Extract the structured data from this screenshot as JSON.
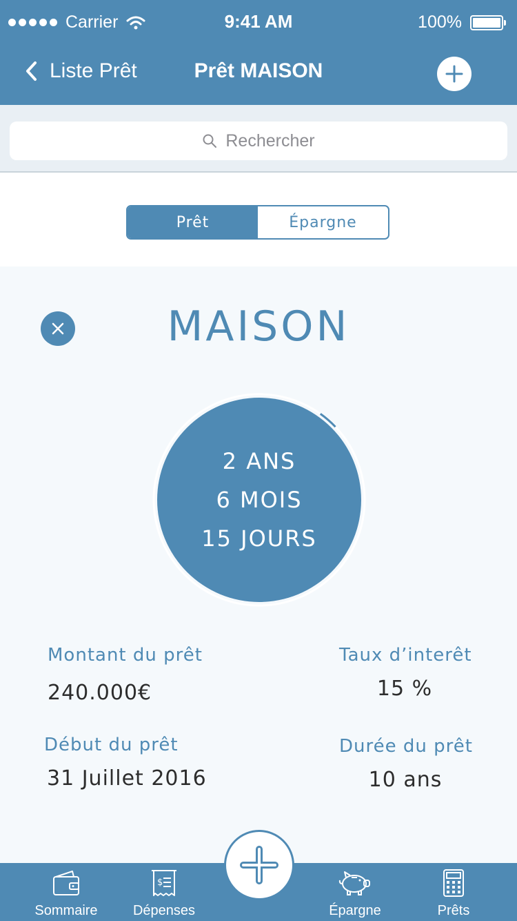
{
  "status_bar": {
    "carrier": "Carrier",
    "time": "9:41 AM",
    "battery": "100%"
  },
  "nav": {
    "back_label": "Liste Prêt",
    "title": "Prêt MAISON"
  },
  "search": {
    "placeholder": "Rechercher"
  },
  "segmented": {
    "options": [
      "Prêt",
      "Épargne"
    ],
    "selected": "Prêt"
  },
  "loan": {
    "name": "MAISON",
    "remaining": [
      "2 ANS",
      "6 MOIS",
      "15 JOURS"
    ],
    "progress_fraction": 0.97,
    "fields": {
      "amount_label": "Montant du prêt",
      "amount_value": "240.000€",
      "rate_label": "Taux d’interêt",
      "rate_value": "15 %",
      "start_label": "Début du prêt",
      "start_value": "31 Juillet 2016",
      "duration_label": "Durée du prêt",
      "duration_value": "10 ans"
    }
  },
  "tabbar": {
    "items": [
      {
        "label": "Sommaire",
        "icon": "wallet-icon"
      },
      {
        "label": "Dépenses",
        "icon": "receipt-icon"
      },
      {
        "label": "Épargne",
        "icon": "piggy-bank-icon"
      },
      {
        "label": "Prêts",
        "icon": "calculator-icon"
      }
    ]
  },
  "colors": {
    "primary": "#4f8ab4",
    "background": "#f5f9fc",
    "text": "#2d2d2d"
  }
}
